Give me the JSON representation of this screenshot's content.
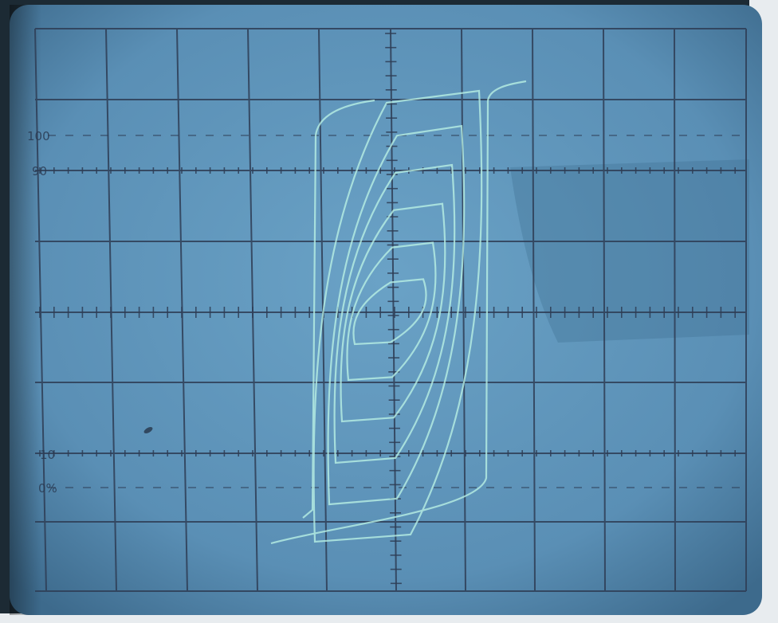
{
  "screen": {
    "labels": {
      "top_100": "100",
      "top_90": "90",
      "bottom_10": "10",
      "bottom_0": "0%"
    }
  },
  "colors": {
    "bezel": "#1c2a34",
    "screen_bg": "#5e93b8",
    "grid_line": "#2e3d55",
    "trace": "#b8f0e4"
  },
  "trace": {
    "description_free": true,
    "loop_count": 6
  }
}
